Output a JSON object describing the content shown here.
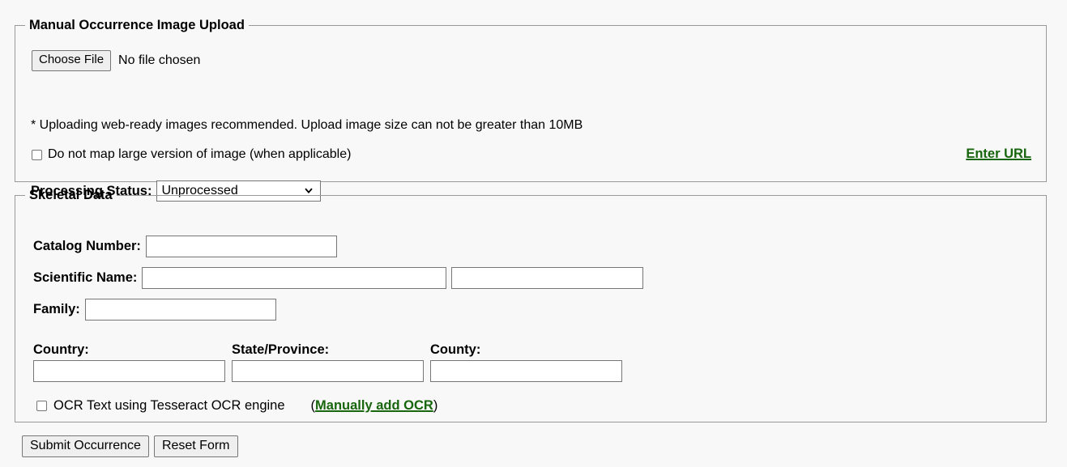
{
  "upload_section": {
    "legend": "Manual Occurrence Image Upload",
    "choose_file_label": "Choose File",
    "file_status": "No file chosen",
    "notice": "* Uploading web-ready images recommended. Upload image size can not be greater than 10MB",
    "no_map_checkbox_label": "Do not map large version of image (when applicable)",
    "processing_status_label": "Processing Status:",
    "processing_status_value": "Unprocessed",
    "processing_status_options": [
      "Unprocessed"
    ],
    "enter_url_link": "Enter URL"
  },
  "skeletal_section": {
    "legend": "Skeletal Data",
    "catalog_number_label": "Catalog Number:",
    "catalog_number_value": "",
    "scientific_name_label": "Scientific Name:",
    "scientific_name_value": "",
    "scientific_name_value2": "",
    "family_label": "Family:",
    "family_value": "",
    "country_label": "Country:",
    "country_value": "",
    "state_label": "State/Province:",
    "state_value": "",
    "county_label": "County:",
    "county_value": "",
    "ocr_checkbox_label": "OCR Text using Tesseract OCR engine",
    "ocr_link_open_paren": "(",
    "ocr_link": "Manually add OCR",
    "ocr_link_close_paren": ")"
  },
  "footer": {
    "submit_label": "Submit Occurrence",
    "reset_label": "Reset Form"
  },
  "colors": {
    "link_green": "#17650c",
    "page_bg": "#f8f8f8",
    "border_gray": "#999999",
    "control_border": "#767676"
  }
}
